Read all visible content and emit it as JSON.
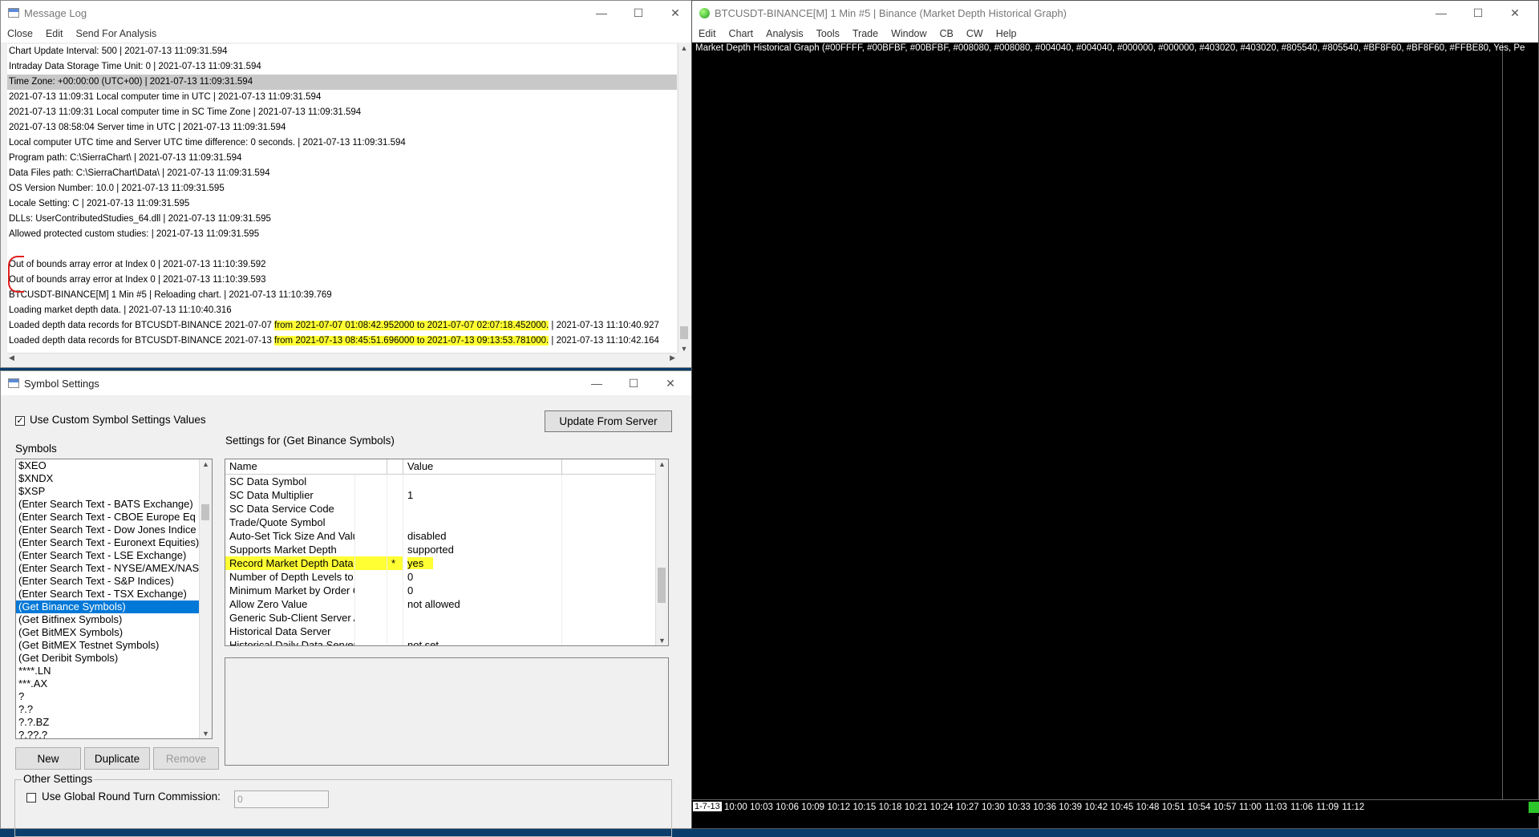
{
  "msglog": {
    "title": "Message Log",
    "menu": [
      "Close",
      "Edit",
      "Send For Analysis"
    ],
    "lines": [
      {
        "text": "Chart Update Interval: 500 | 2021-07-13  11:09:31.594"
      },
      {
        "text": "Intraday Data Storage Time Unit: 0 | 2021-07-13  11:09:31.594"
      },
      {
        "text": "Time Zone: +00:00:00 (UTC+00) | 2021-07-13  11:09:31.594",
        "selected": true
      },
      {
        "text": "2021-07-13  11:09:31  Local computer time in UTC | 2021-07-13  11:09:31.594"
      },
      {
        "text": "2021-07-13  11:09:31  Local computer time in SC Time Zone | 2021-07-13  11:09:31.594"
      },
      {
        "text": "2021-07-13  08:58:04  Server time in UTC | 2021-07-13  11:09:31.594"
      },
      {
        "text": "Local computer UTC time and Server UTC time difference: 0 seconds. | 2021-07-13  11:09:31.594"
      },
      {
        "text": "Program path: C:\\SierraChart\\ | 2021-07-13  11:09:31.594"
      },
      {
        "text": "Data Files path: C:\\SierraChart\\Data\\ | 2021-07-13  11:09:31.594"
      },
      {
        "text": "OS Version Number: 10.0 | 2021-07-13  11:09:31.595"
      },
      {
        "text": "Locale Setting: C | 2021-07-13  11:09:31.595"
      },
      {
        "text": "DLLs: UserContributedStudies_64.dll | 2021-07-13  11:09:31.595"
      },
      {
        "text": "Allowed protected custom studies:  | 2021-07-13  11:09:31.595"
      },
      {
        "text": ""
      },
      {
        "text": "Out of bounds array error at Index 0 | 2021-07-13  11:10:39.592"
      },
      {
        "text": "Out of bounds array error at Index 0 | 2021-07-13  11:10:39.593"
      },
      {
        "text": "BTCUSDT-BINANCE[M]  1 Min   #5 | Reloading chart. | 2021-07-13  11:10:39.769"
      },
      {
        "text": "Loading market depth data. | 2021-07-13  11:10:40.316"
      },
      {
        "pre": "Loaded depth data records for BTCUSDT-BINANCE 2021-07-07 ",
        "hl": "from 2021-07-07  01:08:42.952000 to 2021-07-07  02:07:18.452000.",
        "post": " | 2021-07-13  11:10:40.927"
      },
      {
        "pre": "Loaded depth data records for BTCUSDT-BINANCE 2021-07-13 ",
        "hl": "from 2021-07-13  08:45:51.696000 to 2021-07-13  09:13:53.781000.",
        "post": " | 2021-07-13  11:10:42.164"
      }
    ]
  },
  "symset": {
    "title": "Symbol Settings",
    "use_custom_label": "Use Custom Symbol Settings Values",
    "use_custom_checked": "✓",
    "update_button": "Update From Server",
    "settings_for": "Settings for (Get Binance Symbols)",
    "symbols_label": "Symbols",
    "symbols": [
      "$XEO",
      "$XNDX",
      "$XSP",
      "(Enter Search Text - BATS Exchange)",
      "(Enter Search Text - CBOE Europe Eq",
      "(Enter Search Text - Dow Jones Indice",
      "(Enter Search Text - Euronext Equities)",
      "(Enter Search Text - LSE Exchange)",
      "(Enter Search Text - NYSE/AMEX/NAS",
      "(Enter Search Text - S&P Indices)",
      "(Enter Search Text - TSX Exchange)",
      "(Get Binance Symbols)",
      "(Get Bitfinex Symbols)",
      "(Get BitMEX Symbols)",
      "(Get BitMEX Testnet Symbols)",
      "(Get Deribit Symbols)",
      "****.LN",
      "***.AX",
      "?",
      "?.?",
      "?.?.BZ",
      "?.??.?"
    ],
    "selected_symbol_index": 11,
    "grid_headers": {
      "name": "Name",
      "value": "Value"
    },
    "rows": [
      {
        "name": "SC Data Symbol",
        "mark": "",
        "value": ""
      },
      {
        "name": "SC Data Multiplier",
        "mark": "",
        "value": "1"
      },
      {
        "name": "SC Data Service Code",
        "mark": "",
        "value": ""
      },
      {
        "name": "Trade/Quote Symbol",
        "mark": "",
        "value": ""
      },
      {
        "name": "Auto-Set Tick Size And Value ...",
        "mark": "",
        "value": "disabled"
      },
      {
        "name": "Supports Market Depth",
        "mark": "",
        "value": "supported"
      },
      {
        "name": "Record Market Depth Data",
        "mark": "*",
        "value": "yes",
        "highlight": true
      },
      {
        "name": "Number of Depth Levels to Su...",
        "mark": "",
        "value": "0"
      },
      {
        "name": "Minimum Market by Order Qua...",
        "mark": "",
        "value": "0"
      },
      {
        "name": "Allow Zero Value",
        "mark": "",
        "value": "not allowed"
      },
      {
        "name": "Generic Sub-Client Server Add...",
        "mark": "",
        "value": ""
      },
      {
        "name": "Historical Data Server",
        "mark": "",
        "value": ""
      },
      {
        "name": "Historical Daily Data Server",
        "mark": "",
        "value": "not set"
      }
    ],
    "buttons": {
      "new": "New",
      "duplicate": "Duplicate",
      "remove": "Remove"
    },
    "other_settings": "Other Settings",
    "global_commission_label": "Use Global Round Turn Commission:",
    "commission_value": "0"
  },
  "chart": {
    "title": "BTCUSDT-BINANCE[M]  1 Min  #5 | Binance (Market Depth Historical Graph)",
    "menu": [
      "Edit",
      "Chart",
      "Analysis",
      "Tools",
      "Trade",
      "Window",
      "CB",
      "CW",
      "Help"
    ],
    "header": "Market Depth Historical Graph   (#00FFFF, #00BFBF, #00BFBF, #008080, #008080, #004040, #004040, #000000, #000000, #403020, #403020, #805540, #805540, #BF8F60, #BF8F60, #FFBE80, Yes, Pe",
    "date_label": "1-7-13",
    "time_ticks": [
      "10:00",
      "10:03",
      "10:06",
      "10:09",
      "10:12",
      "10:15",
      "10:18",
      "10:21",
      "10:24",
      "10:27",
      "10:30",
      "10:33",
      "10:36",
      "10:39",
      "10:42",
      "10:45",
      "10:48",
      "10:51",
      "10:54",
      "10:57",
      "11:00",
      "11:03",
      "11:06",
      "11:09",
      "11:12"
    ],
    "price_tag_color": "#2bc42b"
  },
  "colors": {
    "highlight": "#ffff33",
    "selection": "#0078d7",
    "desktop": "#0a3d6b"
  }
}
